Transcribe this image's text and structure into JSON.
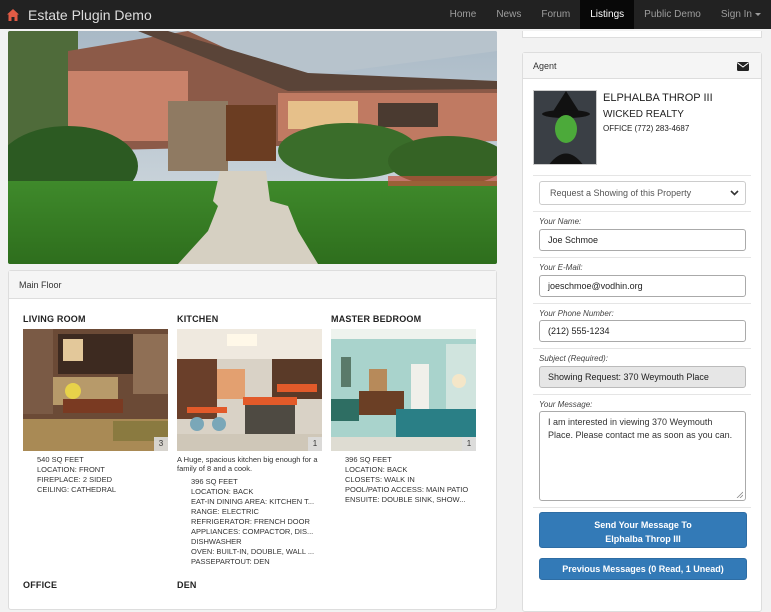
{
  "app": {
    "title": "Estate Plugin Demo",
    "icon": "home-icon"
  },
  "nav": {
    "items": [
      {
        "label": "Home",
        "active": false
      },
      {
        "label": "News",
        "active": false
      },
      {
        "label": "Forum",
        "active": false
      },
      {
        "label": "Listings",
        "active": true
      },
      {
        "label": "Public Demo",
        "active": false
      },
      {
        "label": "Sign In",
        "active": false
      }
    ]
  },
  "floor": {
    "heading": "Main Floor",
    "rooms": [
      {
        "title": "LIVING ROOM",
        "photo_count": "3",
        "description": "",
        "features": [
          "540 SQ FEET",
          "LOCATION: FRONT",
          "FIREPLACE: 2 SIDED",
          "CEILING: CATHEDRAL"
        ]
      },
      {
        "title": "KITCHEN",
        "photo_count": "1",
        "description": "A Huge, spacious kitchen big enough for a family of 8 and a cook.",
        "features": [
          "396 SQ FEET",
          "LOCATION: BACK",
          "EAT-IN DINING AREA: KITCHEN T...",
          "RANGE: ELECTRIC",
          "REFRIGERATOR: FRENCH DOOR",
          "APPLIANCES: COMPACTOR, DIS...",
          "DISHWASHER",
          "OVEN: BUILT-IN, DOUBLE, WALL ...",
          "PASSEPARTOUT: DEN"
        ]
      },
      {
        "title": "MASTER BEDROOM",
        "photo_count": "1",
        "description": "",
        "features": [
          "396 SQ FEET",
          "LOCATION: BACK",
          "CLOSETS: WALK IN",
          "POOL/PATIO ACCESS: MAIN PATIO",
          "ENSUITE: DOUBLE SINK, SHOW..."
        ]
      },
      {
        "title": "OFFICE"
      },
      {
        "title": "DEN"
      }
    ]
  },
  "agent": {
    "heading": "Agent",
    "name": "ELPHALBA THROP III",
    "company": "WICKED REALTY",
    "phone": "OFFICE (772) 283-4687"
  },
  "form": {
    "request_type": "Request a Showing of this Property",
    "name_label": "Your Name:",
    "name_value": "Joe Schmoe",
    "email_label": "Your E-Mail:",
    "email_value": "joeschmoe@vodhin.org",
    "phone_label": "Your Phone Number:",
    "phone_value": "(212) 555-1234",
    "subject_label": "Subject (Required):",
    "subject_value": "Showing Request: 370 Weymouth Place",
    "message_label": "Your Message:",
    "message_value": "I am interested in viewing 370 Weymouth Place. Please contact me as soon as you can.",
    "send_line1": "Send Your Message To",
    "send_line2": "Elphalba Throp III",
    "previous_label": "Previous Messages (0 Read, 1 Unead)"
  }
}
